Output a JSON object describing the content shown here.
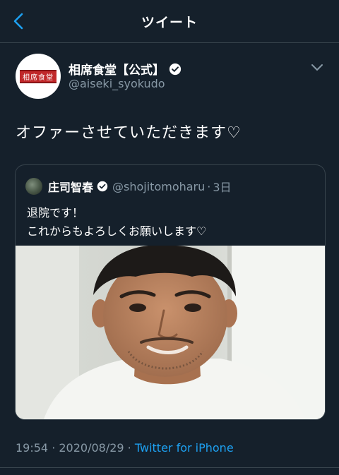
{
  "nav": {
    "title": "ツイート"
  },
  "tweet": {
    "display_name": "相席食堂【公式】",
    "handle": "@aiseki_syokudo",
    "avatar_text": "相席食堂",
    "text": "オファーさせていただきます♡"
  },
  "quote": {
    "display_name": "庄司智春",
    "handle": "@shojitomoharu",
    "separator": "·",
    "time": "3日",
    "lines": [
      "退院です！",
      "これからもよろしくお願いします♡"
    ]
  },
  "meta": {
    "time": "19:54",
    "separator": " · ",
    "date": "2020/08/29",
    "client": "Twitter for iPhone"
  },
  "colors": {
    "background": "#15202b",
    "accent": "#1da1f2",
    "secondary_text": "#8899a6",
    "divider": "#38444d"
  }
}
